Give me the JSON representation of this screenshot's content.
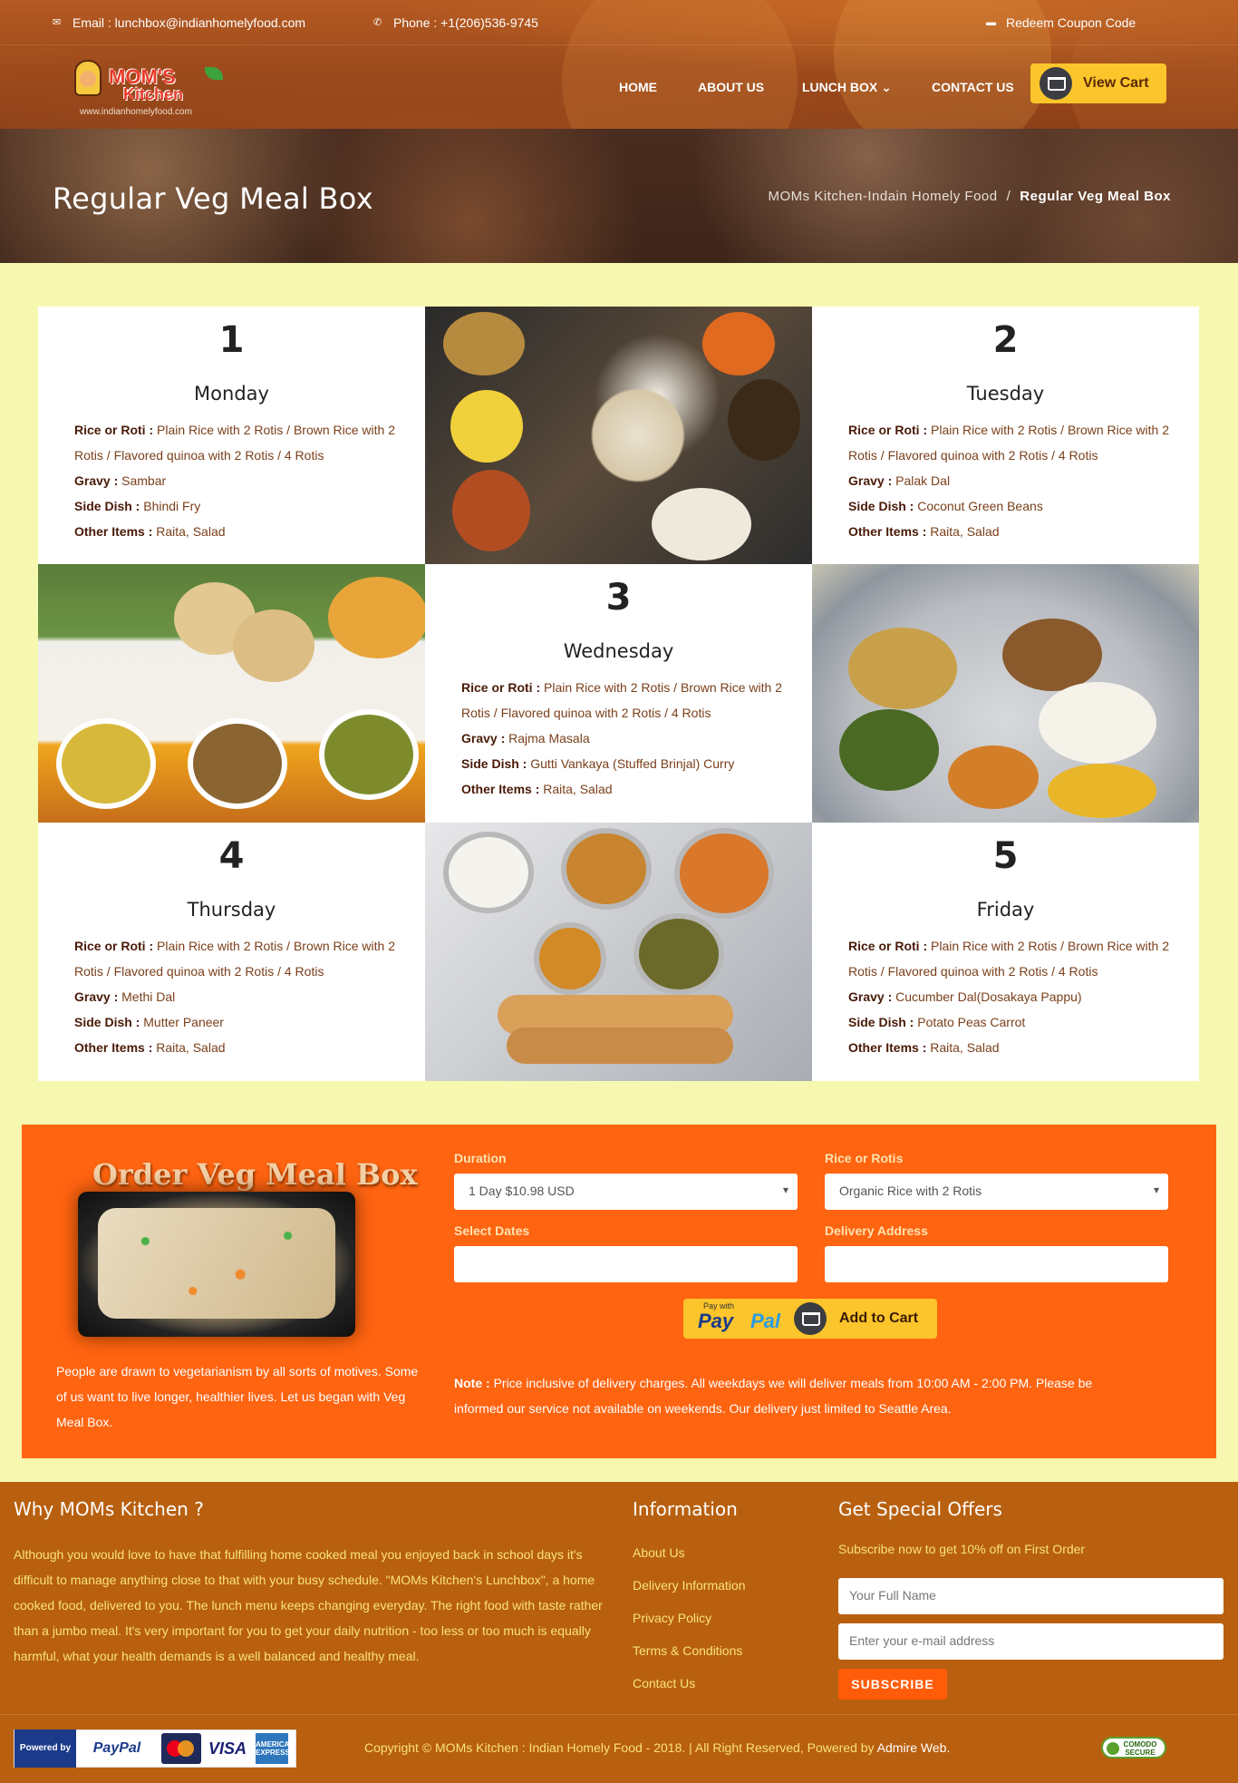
{
  "topbar": {
    "email": "Email : lunchbox@indianhomelyfood.com",
    "phone": "Phone : +1(206)536-9745",
    "coupon": "Redeem Coupon Code"
  },
  "logo": {
    "line1": "MOM'S",
    "line2": "Kitchen",
    "url": "www.indianhomelyfood.com"
  },
  "nav": {
    "items": [
      {
        "label": "HOME"
      },
      {
        "label": "ABOUT US"
      },
      {
        "label": "LUNCH BOX"
      },
      {
        "label": "CONTACT US"
      }
    ],
    "cart": "View Cart"
  },
  "banner": {
    "title": "Regular Veg Meal Box",
    "crumb_home": "MOMs Kitchen-Indain Homely Food",
    "crumb_sep": "/",
    "crumb_current": "Regular Veg Meal Box"
  },
  "menu": [
    {
      "num": "1",
      "day": "Monday",
      "rice": "Plain Rice with 2 Rotis / Brown Rice with 2 Rotis / Flavored quinoa with 2 Rotis / 4 Rotis",
      "gravy": "Sambar",
      "side": "Bhindi Fry",
      "other": "Raita, Salad"
    },
    {
      "num": "2",
      "day": "Tuesday",
      "rice": "Plain Rice with 2 Rotis / Brown Rice with 2 Rotis / Flavored quinoa with 2 Rotis / 4 Rotis",
      "gravy": "Palak Dal",
      "side": "Coconut Green Beans",
      "other": "Raita, Salad"
    },
    {
      "num": "3",
      "day": "Wednesday",
      "rice": "Plain Rice with 2 Rotis / Brown Rice with 2 Rotis / Flavored quinoa with 2 Rotis / 4 Rotis",
      "gravy": "Rajma Masala",
      "side": "Gutti Vankaya (Stuffed Brinjal) Curry",
      "other": "Raita, Salad"
    },
    {
      "num": "4",
      "day": "Thursday",
      "rice": "Plain Rice with 2 Rotis / Brown Rice with 2 Rotis / Flavored quinoa with 2 Rotis / 4 Rotis",
      "gravy": "Methi Dal",
      "side": "Mutter Paneer",
      "other": "Raita, Salad"
    },
    {
      "num": "5",
      "day": "Friday",
      "rice": "Plain Rice with 2 Rotis / Brown Rice with 2 Rotis / Flavored quinoa with 2 Rotis / 4 Rotis",
      "gravy": "Cucumber Dal(Dosakaya Pappu)",
      "side": "Potato Peas Carrot",
      "other": "Raita, Salad"
    }
  ],
  "labels": {
    "rice": "Rice or Roti :",
    "gravy": "Gravy :",
    "side": "Side Dish :",
    "other": "Other Items :"
  },
  "order": {
    "title": "Order Veg Meal Box",
    "description": "People are drawn to vegetarianism by all sorts of motives. Some of us want to live longer, healthier lives. Let us began with Veg Meal Box.",
    "duration_label": "Duration",
    "duration_value": "1 Day $10.98 USD",
    "rice_label": "Rice or Rotis",
    "rice_value": "Organic Rice with 2 Rotis",
    "dates_label": "Select Dates",
    "dates_value": "",
    "address_label": "Delivery Address",
    "address_value": "",
    "paypal_with": "Pay with",
    "paypal_pay": "Pay",
    "paypal_pal": "Pal",
    "add_to_cart": "Add to Cart",
    "note_label": "Note :",
    "note": "Price inclusive of delivery charges. All weekdays we will deliver meals from 10:00 AM - 2:00 PM. Please be informed our service not available on weekends. Our delivery just limited to Seattle Area."
  },
  "footer": {
    "why_title": "Why MOMs Kitchen ?",
    "why_text": "Although you would love to have that fulfilling home cooked meal you enjoyed back in school days it's difficult to manage anything close to that with your busy schedule. \"MOMs Kitchen's Lunchbox\", a home cooked food, delivered to you. The lunch menu keeps changing everyday. The right food with taste rather than a jumbo meal. It's very important for you to get your daily nutrition - too less or too much is equally harmful, what your health demands is a well balanced and healthy meal.",
    "info_title": "Information",
    "links": [
      "About Us",
      "Delivery Information",
      "Privacy Policy",
      "Terms & Conditions",
      "Contact Us"
    ],
    "offers_title": "Get Special Offers",
    "offers_text": "Subscribe now to get 10% off on First Order",
    "name_placeholder": "Your Full Name",
    "email_placeholder": "Enter your e-mail address",
    "subscribe": "SUBSCRIBE",
    "powered_by": "Powered by",
    "paypal": "PayPal",
    "visa": "VISA",
    "amex": "AMERICAN EXPRESS",
    "copyright": "Copyright © MOMs Kitchen : Indian Homely Food - 2018. | All Right Reserved, Powered by",
    "admire": "Admire Web.",
    "comodo": "COMODO SECURE"
  },
  "colors": {
    "accent_orange": "#ff6411",
    "cart_yellow": "#fcc52b",
    "footer_brown": "#b8600f",
    "page_bg": "#f7f8b0"
  }
}
